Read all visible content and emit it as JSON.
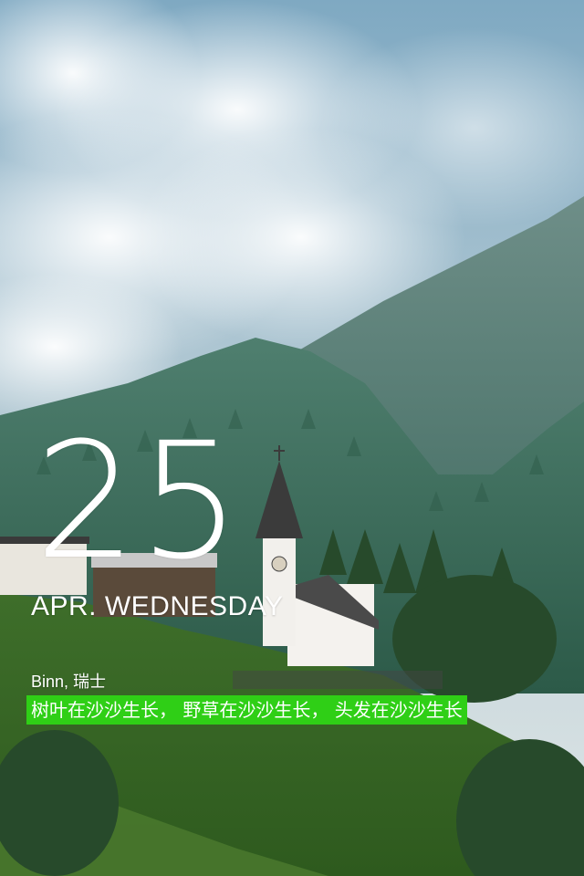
{
  "calendar": {
    "day": "25",
    "month_weekday": "APR. WEDNESDAY"
  },
  "location": "Binn, 瑞士",
  "quote": "树叶在沙沙生长， 野草在沙沙生长， 头发在沙沙生长",
  "colors": {
    "quote_highlight": "#2fcf16",
    "text": "#ffffff"
  },
  "background": {
    "description_icon": "landscape-photo"
  }
}
